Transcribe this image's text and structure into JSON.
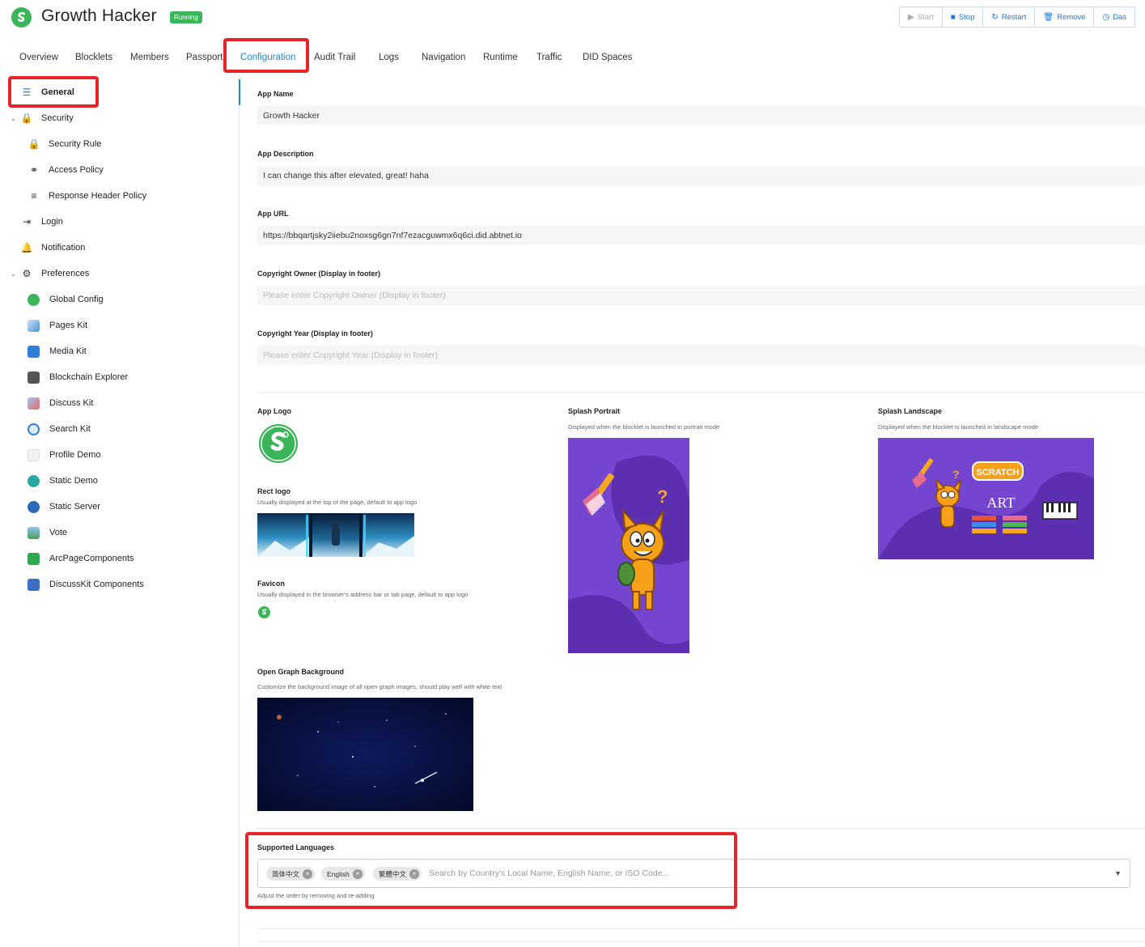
{
  "header": {
    "app_title": "Growth Hacker",
    "status": "Running",
    "actions": [
      {
        "label": "Start",
        "icon": "play-icon"
      },
      {
        "label": "Stop",
        "icon": "stop-icon"
      },
      {
        "label": "Restart",
        "icon": "restart-icon"
      },
      {
        "label": "Remove",
        "icon": "trash-icon"
      },
      {
        "label": "Das",
        "icon": "dashboard-icon"
      }
    ]
  },
  "tabs": [
    {
      "label": "Overview"
    },
    {
      "label": "Blocklets"
    },
    {
      "label": "Members"
    },
    {
      "label": "Passport"
    },
    {
      "label": "Configuration",
      "active": true
    },
    {
      "label": "Audit Trail"
    },
    {
      "label": "Logs"
    },
    {
      "label": "Navigation"
    },
    {
      "label": "Runtime"
    },
    {
      "label": "Traffic"
    },
    {
      "label": "DID Spaces"
    }
  ],
  "sidebar": {
    "items": [
      {
        "label": "General",
        "icon": "sliders-icon",
        "active": true
      },
      {
        "label": "Security",
        "icon": "lock-icon",
        "expanded": true
      },
      {
        "label": "Security Rule",
        "icon": "lock-icon"
      },
      {
        "label": "Access Policy",
        "icon": "key-icon"
      },
      {
        "label": "Response Header Policy",
        "icon": "list-icon"
      },
      {
        "label": "Login",
        "icon": "login-icon"
      },
      {
        "label": "Notification",
        "icon": "bell-icon"
      },
      {
        "label": "Preferences",
        "icon": "gear-icon",
        "expanded": true
      },
      {
        "label": "Global Config",
        "icon": "global-config-icon"
      },
      {
        "label": "Pages Kit",
        "icon": "pages-kit-icon"
      },
      {
        "label": "Media Kit",
        "icon": "media-kit-icon"
      },
      {
        "label": "Blockchain Explorer",
        "icon": "blockchain-explorer-icon"
      },
      {
        "label": "Discuss Kit",
        "icon": "discuss-kit-icon"
      },
      {
        "label": "Search Kit",
        "icon": "search-kit-icon"
      },
      {
        "label": "Profile Demo",
        "icon": "profile-demo-icon"
      },
      {
        "label": "Static Demo",
        "icon": "static-demo-icon"
      },
      {
        "label": "Static Server",
        "icon": "static-server-icon"
      },
      {
        "label": "Vote",
        "icon": "vote-icon"
      },
      {
        "label": "ArcPageComponents",
        "icon": "arc-page-components-icon"
      },
      {
        "label": "DiscussKit Components",
        "icon": "discusskit-components-icon"
      }
    ]
  },
  "form": {
    "app_name": {
      "label": "App Name",
      "value": "Growth Hacker"
    },
    "app_description": {
      "label": "App Description",
      "value": "I can change this after elevated, great! haha"
    },
    "app_url": {
      "label": "App URL",
      "value": "https://bbqartjsky2iiebu2noxsg6gn7nf7ezacguwmx6q6ci.did.abtnet.io"
    },
    "copyright_owner": {
      "label": "Copyright Owner (Display in footer)",
      "placeholder": "Please enter Copyright Owner (Display in footer)"
    },
    "copyright_year": {
      "label": "Copyright Year (Display in footer)",
      "placeholder": "Please enter Copyright Year (Display in footer)"
    }
  },
  "images": {
    "app_logo": {
      "label": "App Logo"
    },
    "rect_logo": {
      "label": "Rect logo",
      "desc": "Usually displayed at the top of the page, default to app logo"
    },
    "favicon": {
      "label": "Favicon",
      "desc": "Usually displayed in the browser's address bar or tab page, default to app logo"
    },
    "og_background": {
      "label": "Open Graph Background",
      "desc": "Customize the background image of all open graph images, should play well with white text"
    },
    "splash_portrait": {
      "label": "Splash Portrait",
      "desc": "Displayed when the blocklet is launched in portrait mode"
    },
    "splash_landscape": {
      "label": "Splash Landscape",
      "desc": "Displayed when the blocklet is launched in landscape mode",
      "logo_text": "SCRATCH",
      "art_text": "ART"
    }
  },
  "languages": {
    "label": "Supported Languages",
    "selected": [
      "简体中文",
      "English",
      "繁體中文"
    ],
    "placeholder": "Search by Country's Local Name, English Name, or ISO Code...",
    "hint": "Adjust the order by removing and re-adding"
  },
  "colors": {
    "accent": "#1e88c8",
    "running": "#3bb55a",
    "highlight": "#e8242a",
    "splash_bg": "#7446d0"
  }
}
